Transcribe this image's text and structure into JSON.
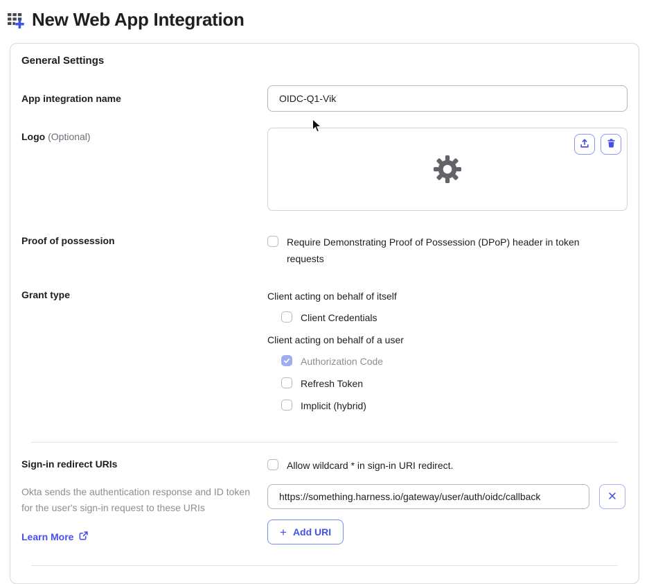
{
  "page": {
    "title": "New Web App Integration"
  },
  "card": {
    "heading": "General Settings",
    "app_name": {
      "label": "App integration name",
      "value": "OIDC-Q1-Vik"
    },
    "logo": {
      "label": "Logo",
      "optional_hint": "(Optional)"
    },
    "dpop": {
      "label": "Proof of possession",
      "checkbox_label": "Require Demonstrating Proof of Possession (DPoP) header in token requests",
      "checked": false
    },
    "grant_type": {
      "label": "Grant type",
      "self_title": "Client acting on behalf of itself",
      "self_options": [
        {
          "label": "Client Credentials",
          "checked": false
        }
      ],
      "user_title": "Client acting on behalf of a user",
      "user_options": [
        {
          "label": "Authorization Code",
          "checked": true,
          "disabled": true
        },
        {
          "label": "Refresh Token",
          "checked": false
        },
        {
          "label": "Implicit (hybrid)",
          "checked": false
        }
      ]
    },
    "redirect_uris": {
      "label": "Sign-in redirect URIs",
      "description": "Okta sends the authentication response and ID token for the user's sign-in request to these URIs",
      "learn_more_label": "Learn More",
      "wildcard_label": "Allow wildcard * in sign-in URI redirect.",
      "uri_value": "https://something.harness.io/gateway/user/auth/oidc/callback",
      "add_uri_plus": "+",
      "add_uri_label": "Add URI"
    }
  },
  "icons": {
    "app": "grid-with-plus",
    "logo_placeholder": "gear",
    "upload": "upload-tray-arrow",
    "delete": "trash-can",
    "remove_uri": "x-close",
    "learn_more": "external-link",
    "checked": "checkmark"
  },
  "colors": {
    "accent_blue": "#4450e8",
    "accent_border": "#7b89f2",
    "checked_checkbox": "#a0adf0",
    "text": "#1d1d21",
    "muted_text": "#8d8d95",
    "card_border": "#d7d7dc",
    "divider": "#e1e1e6"
  }
}
